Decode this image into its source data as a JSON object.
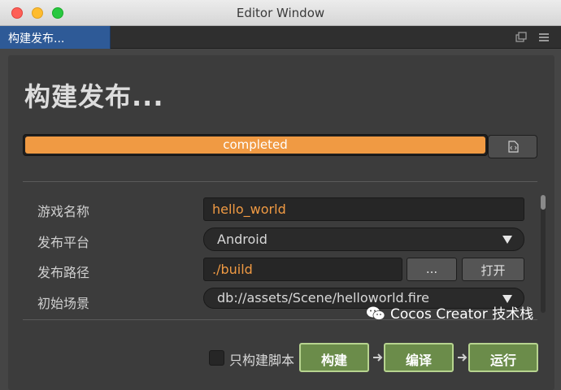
{
  "window": {
    "title": "Editor Window"
  },
  "tab": {
    "label": "构建发布..."
  },
  "panel": {
    "heading": "构建发布...",
    "progress": {
      "status_text": "completed",
      "fraction": 1.0
    },
    "fields": {
      "game_name": {
        "label": "游戏名称",
        "value": "hello_world"
      },
      "platform": {
        "label": "发布平台",
        "value": "Android"
      },
      "build_path": {
        "label": "发布路径",
        "value": "./build",
        "browse_label": "...",
        "open_label": "打开"
      },
      "start_scene": {
        "label": "初始场景",
        "value": "db://assets/Scene/helloworld.fire"
      }
    },
    "actions": {
      "script_only_label": "只构建脚本",
      "build_label": "构建",
      "compile_label": "编译",
      "run_label": "运行"
    }
  },
  "watermark": {
    "text": "Cocos Creator 技术栈"
  },
  "colors": {
    "accent": "#f09a43",
    "tab_active": "#2e5a97",
    "action_green": "#6b8c4a"
  },
  "icons": {
    "log": "code-file-icon",
    "popout": "popout-icon",
    "menu": "hamburger-menu-icon",
    "dropdown": "caret-down-icon",
    "arrow": "arrow-right-icon",
    "wechat": "wechat-icon"
  }
}
